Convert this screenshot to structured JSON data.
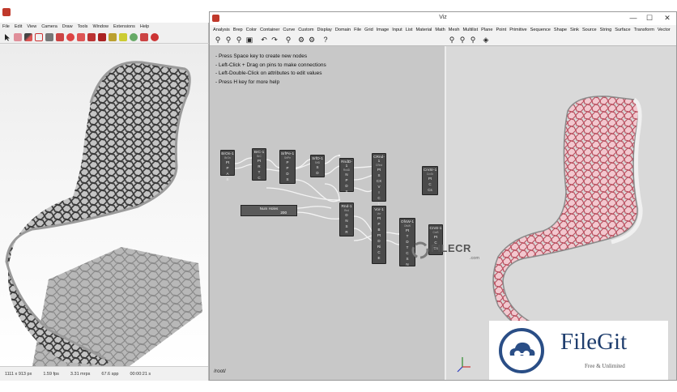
{
  "left_window": {
    "menu": [
      "File",
      "Edit",
      "View",
      "Camera",
      "Draw",
      "Tools",
      "Window",
      "Extensions",
      "Help"
    ],
    "status": {
      "resolution": "1111 x 913 px",
      "fps": "1.59 fps",
      "mrps": "3.31 mrps",
      "spp": "67.6 spp",
      "time": "00:00:21 s"
    }
  },
  "viz_window": {
    "title": "Viz",
    "window_controls": {
      "minimize": "—",
      "maximize": "☐",
      "close": "✕"
    },
    "menu": [
      "Analysis",
      "Brep",
      "Color",
      "Container",
      "Curve",
      "Custom",
      "Display",
      "Domain",
      "File",
      "Grid",
      "Image",
      "Input",
      "List",
      "Material",
      "Math",
      "Mesh",
      "Multilist",
      "Plane",
      "Point",
      "Primitive",
      "Sequence",
      "Shape",
      "Sink",
      "Source",
      "String",
      "Surface",
      "Transform",
      "Vector"
    ],
    "help_lines": [
      "- Press Space key to create new nodes",
      "- Left-Click + Drag on pins to make connections",
      "- Left-Double-Click on attributes to edit values",
      "- Press H key for more help"
    ],
    "nodes": [
      {
        "title": "BrOn-1",
        "sub": "BrOn",
        "pins": [
          "Pt",
          "P",
          "A",
          "B"
        ]
      },
      {
        "title": "BrC-1",
        "sub": "BrC",
        "pins": [
          "Pt",
          "R",
          "T",
          "C"
        ]
      },
      {
        "title": "SrfPe-1",
        "sub": "SrfPe",
        "pins": [
          "P",
          "P",
          "D",
          "S"
        ]
      },
      {
        "title": "SrfD-1",
        "sub": "SrfD",
        "pins": [
          "S",
          "D"
        ]
      },
      {
        "title": "RndD-1",
        "sub": "RndD",
        "pins": [
          "N",
          "P",
          "D",
          "S"
        ]
      },
      {
        "title": "CRnd-1",
        "sub": "CRnd",
        "pins": [
          "Pt",
          "S",
          "CX",
          "V",
          "I",
          "C",
          "L"
        ]
      },
      {
        "title": "CrvSr-1",
        "sub": "CrvSr",
        "pins": [
          "Pt",
          "C",
          "Cs"
        ]
      },
      {
        "title": "Rnd-1",
        "sub": "Rnd",
        "pins": [
          "D",
          "N",
          "S",
          "R"
        ]
      },
      {
        "title": "Vor-1",
        "sub": "Vor",
        "pins": [
          "Pt",
          "P",
          "B",
          "Pt",
          "D",
          "Ri",
          "C",
          "E"
        ]
      },
      {
        "title": "OfsW-1",
        "sub": "OfsW",
        "pins": [
          "Pt",
          "T",
          "D",
          "T",
          "C",
          "S",
          "N"
        ]
      },
      {
        "title": "CrvS-1",
        "sub": "CrvS",
        "pins": [
          "Pt",
          "C",
          "Cs"
        ]
      }
    ],
    "hole_number": {
      "label": "Num Holes",
      "value": "200"
    },
    "root_path": "/root/"
  },
  "watermarks": {
    "filecr": {
      "word": "FILECR",
      "domain": ".com"
    },
    "filegit": {
      "name": "FileGit",
      "tagline": "Free & Unlimited"
    }
  }
}
